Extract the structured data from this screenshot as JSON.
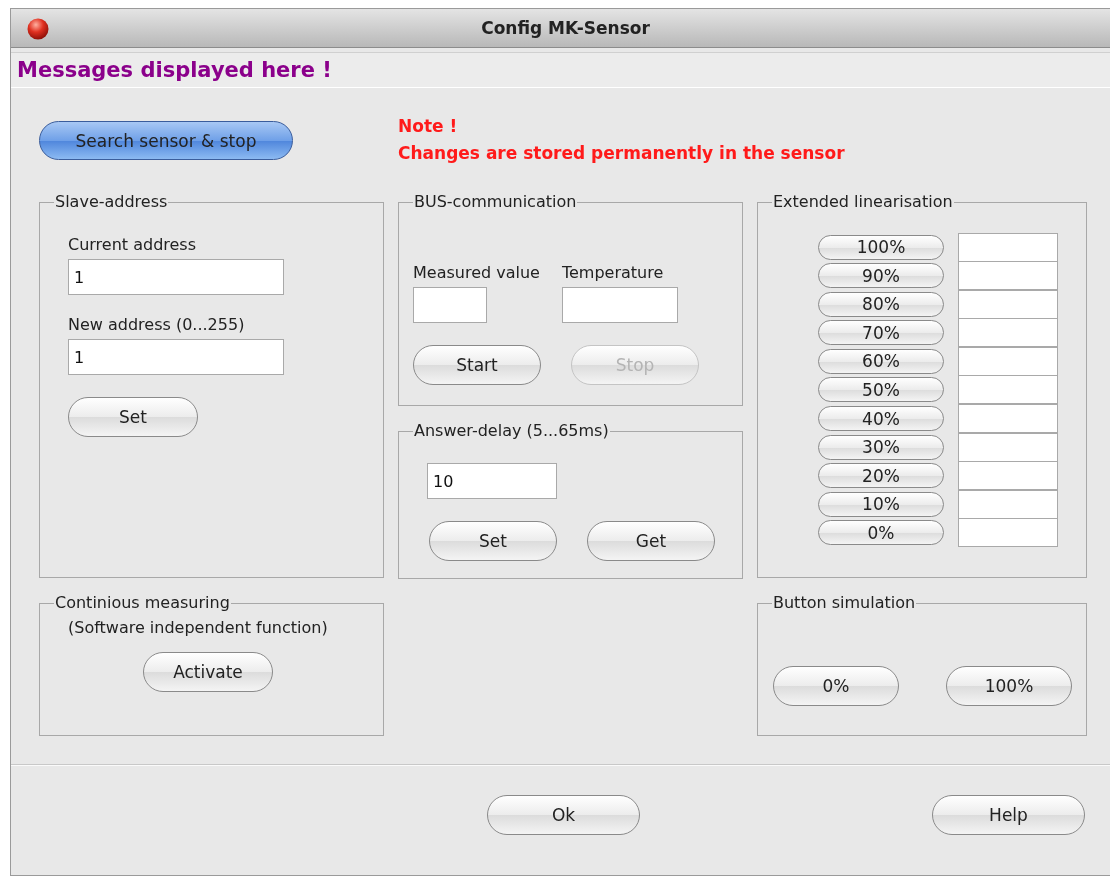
{
  "window": {
    "title": "Config MK-Sensor"
  },
  "message": "Messages displayed here !",
  "search_button": {
    "label": "Search sensor & stop",
    "default": true
  },
  "note": {
    "title": "Note !",
    "text": "Changes are stored permanently in the sensor"
  },
  "slave_address": {
    "title": "Slave-address",
    "current_label": "Current address",
    "current_value": "1",
    "new_label": "New address (0...255)",
    "new_value": "1",
    "set_button": "Set"
  },
  "bus_communication": {
    "title": "BUS-communication",
    "measured_label": "Measured value",
    "temperature_label": "Temperature",
    "buttons": [
      {
        "label": "Start",
        "disabled": false
      },
      {
        "label": "Stop",
        "disabled": true
      }
    ]
  },
  "answer_delay": {
    "title": "Answer-delay (5...65ms)",
    "value": "10",
    "buttons": [
      {
        "label": "Set",
        "disabled": false
      },
      {
        "label": "Get",
        "disabled": false
      }
    ]
  },
  "extended_linearisation": {
    "title": "Extended linearisation",
    "rows": [
      {
        "label": "100%"
      },
      {
        "label": "90%"
      },
      {
        "label": "80%"
      },
      {
        "label": "70%"
      },
      {
        "label": "60%"
      },
      {
        "label": "50%"
      },
      {
        "label": "40%"
      },
      {
        "label": "30%"
      },
      {
        "label": "20%"
      },
      {
        "label": "10%"
      },
      {
        "label": "0%"
      }
    ]
  },
  "continuous_measuring": {
    "title": "Continious measuring",
    "subtitle": "(Software independent function)",
    "button": "Activate"
  },
  "button_simulation": {
    "title": "Button simulation",
    "buttons": [
      "0%",
      "100%"
    ]
  },
  "footer_buttons": [
    "Ok",
    "Help"
  ]
}
